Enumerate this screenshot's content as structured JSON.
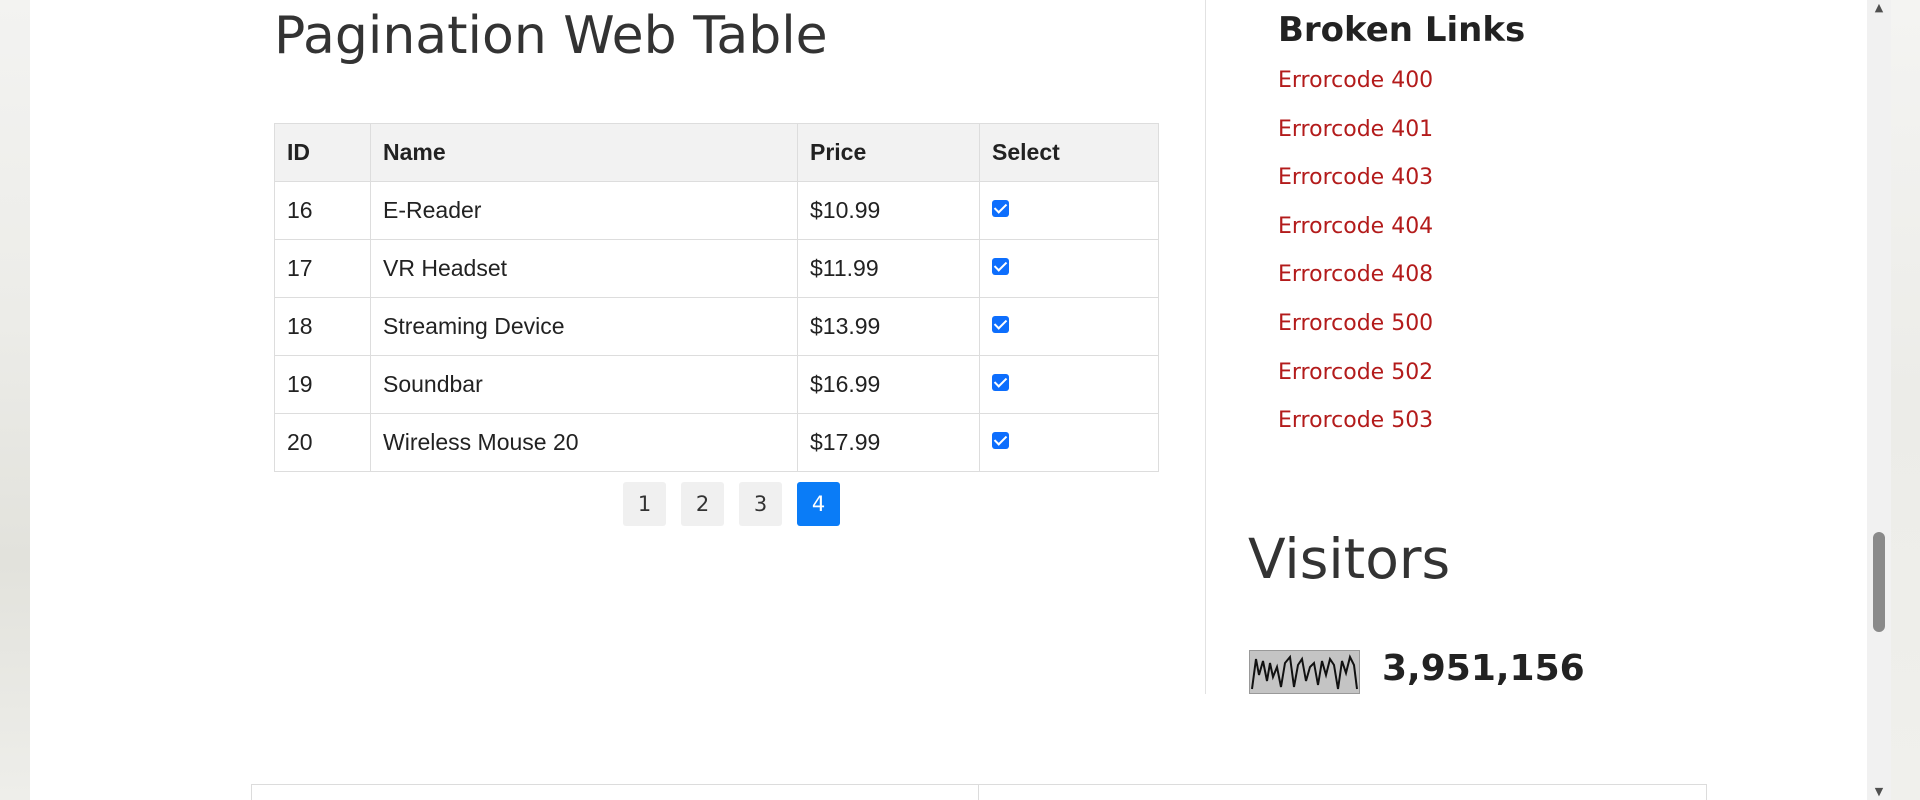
{
  "main": {
    "title": "Pagination Web Table",
    "table": {
      "headers": [
        "ID",
        "Name",
        "Price",
        "Select"
      ],
      "rows": [
        {
          "id": "16",
          "name": "E-Reader",
          "price": "$10.99",
          "selected": true
        },
        {
          "id": "17",
          "name": "VR Headset",
          "price": "$11.99",
          "selected": true
        },
        {
          "id": "18",
          "name": "Streaming Device",
          "price": "$13.99",
          "selected": true
        },
        {
          "id": "19",
          "name": "Soundbar",
          "price": "$16.99",
          "selected": true
        },
        {
          "id": "20",
          "name": "Wireless Mouse 20",
          "price": "$17.99",
          "selected": true
        }
      ]
    },
    "pagination": {
      "pages": [
        "1",
        "2",
        "3",
        "4"
      ],
      "active": "4"
    }
  },
  "sidebar": {
    "broken_links": {
      "title": "Broken Links",
      "links": [
        "Errorcode 400",
        "Errorcode 401",
        "Errorcode 403",
        "Errorcode 404",
        "Errorcode 408",
        "Errorcode 500",
        "Errorcode 502",
        "Errorcode 503"
      ]
    },
    "visitors": {
      "title": "Visitors",
      "count": "3,951,156",
      "graph_icon": "visitor-sparkline-graph"
    }
  },
  "colors": {
    "link": "#b31b1b",
    "active_page": "#0a7cf7",
    "checkbox": "#0d6efd",
    "header_bg": "#f2f2f2"
  }
}
